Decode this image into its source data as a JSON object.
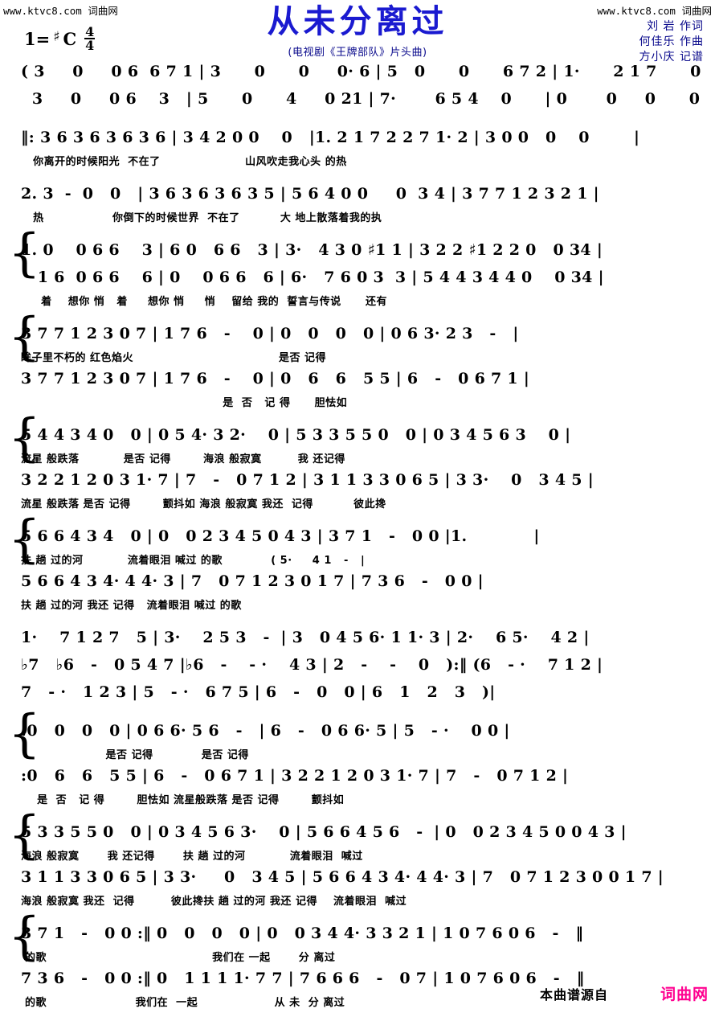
{
  "watermark": {
    "left_url": "www.ktvc8.com",
    "left_site": "词曲网",
    "right_url": "www.ktvc8.com",
    "right_site": "词曲网"
  },
  "header": {
    "title": "从未分离过",
    "subtitle": "(电视剧《王牌部队》片头曲)",
    "key_label": "1=",
    "key_accidental": "♯",
    "key_letter": "C",
    "time_numerator": "4",
    "time_denominator": "4",
    "credits": [
      "刘 岩 作词",
      "何佳乐 作曲",
      "方小庆 记谱"
    ]
  },
  "colors": {
    "title": "#1a1ad0",
    "subtitle": "#0a0a8c",
    "credits": "#0a0a8c",
    "notation": "#000000",
    "logo": "#ff0090"
  },
  "footer": {
    "source_text": "本曲谱源自",
    "logo_text": "词曲网"
  },
  "music": {
    "systems": [
      {
        "id": "sys-1-intro",
        "brace": false,
        "rows": [
          {
            "type": "notes",
            "voice": "upper",
            "text": "( 3     0     0 6  6 7 1 | 3      0      0     0· 6 | 5   0      0      6 7 2 | 1·      2 1 7      0        |"
          },
          {
            "type": "notes",
            "voice": "lower",
            "text": "  3     0     0 6    3   | 5      0      4     0 21 | 7·       6 5 4    0      | 0       0     0      0     )|"
          }
        ]
      },
      {
        "id": "sys-2",
        "brace": false,
        "rows": [
          {
            "type": "notes",
            "voice": "upper",
            "text": "‖: 3 6 3 6 3 6 3 6 | 3 4 2 0 0    0   |1. 2 1 7 2 2 7 1· 2 | 3 0 0   0    0        |"
          },
          {
            "type": "lyrics",
            "voice": "upper",
            "text": "   你离开的时候阳光  不在了                     山风吹走我心头 的热"
          }
        ]
      },
      {
        "id": "sys-3",
        "brace": false,
        "rows": [
          {
            "type": "notes",
            "voice": "upper",
            "text": "2. 3  -  0   0   | 3 6 3 6 3 6 3 5 | 5 6 4 0 0     0  3 4 | 3 7 7 1 2 3 2 1 |"
          },
          {
            "type": "lyrics",
            "voice": "upper",
            "text": "   热                 你倒下的时候世界  不在了          大 地上散落着我的执"
          }
        ]
      },
      {
        "id": "sys-4",
        "brace": true,
        "rows": [
          {
            "type": "notes",
            "voice": "upper",
            "text": "1. 0    0 6 6    3 | 6 0   6 6   3 | 3·   4 3 0 ♯1 1 | 3 2 2 ♯1 2 2 0   0 34 |"
          },
          {
            "type": "notes",
            "voice": "lower",
            "text": "   1 6  0 6 6    6 | 0    0 6 6   6 | 6·   7 6 0 3  3 | 5 4 4 3 4 4 0    0 34 |"
          },
          {
            "type": "lyrics",
            "voice": "both",
            "text": "     着    想你 悄   着     想你 悄     悄    留给 我的  誓言与传说      还有"
          }
        ]
      },
      {
        "id": "sys-5",
        "brace": true,
        "rows": [
          {
            "type": "notes",
            "voice": "upper",
            "text": "3 7 7 1 2 3 0 7 | 1 7 6   -    0 | 0   0   0   0 | 0 6 3· 2 3   -   |"
          },
          {
            "type": "lyrics",
            "voice": "upper",
            "text": "眸子里不朽的 红色焰火                                    是否 记得"
          },
          {
            "type": "notes",
            "voice": "lower",
            "text": "3 7 7 1 2 3 0 7 | 1 7 6   -    0 | 0   6   6   5 5 | 6   -   0 6 7 1 |"
          },
          {
            "type": "lyrics",
            "voice": "lower",
            "text": "                                                  是  否   记 得      胆怯如"
          }
        ]
      },
      {
        "id": "sys-6",
        "brace": true,
        "rows": [
          {
            "type": "notes",
            "voice": "upper",
            "text": "5 4 4 3 4 0   0 | 0 5 4· 3 2·    0 | 5 3 3 5 5 0   0 | 0 3 4 5 6 3    0 |"
          },
          {
            "type": "lyrics",
            "voice": "upper",
            "text": "流星 般跌落           是否 记得        海浪 般寂寞         我 还记得"
          },
          {
            "type": "notes",
            "voice": "lower",
            "text": "3 2 2 1 2 0 3 1· 7 | 7   -   0 7 1 2 | 3 1 1 3 3 0 6 5 | 3 3·    0   3 4 5 |"
          },
          {
            "type": "lyrics",
            "voice": "lower",
            "text": "流星 般跌落 是否 记得        颤抖如 海浪 般寂寞 我还  记得          彼此搀"
          }
        ]
      },
      {
        "id": "sys-7",
        "brace": true,
        "rows": [
          {
            "type": "notes",
            "voice": "upper",
            "text": "5 6 6 4 3 4   0 | 0   0 2 3 4 5 0 4 3 | 3 7 1   -   0 0 |1.            |"
          },
          {
            "type": "lyrics",
            "voice": "upper",
            "text": "扶 趟 过的河           流着眼泪 喊过 的歌            ( 5·     4 1   -   |"
          },
          {
            "type": "notes",
            "voice": "lower",
            "text": "5 6 6 4 3 4· 4 4· 3 | 7   0 7 1 2 3 0 1 7 | 7 3 6   -   0 0 |"
          },
          {
            "type": "lyrics",
            "voice": "lower",
            "text": "扶 趟 过的河 我还 记得   流着眼泪 喊过 的歌"
          }
        ]
      },
      {
        "id": "sys-8-interlude",
        "brace": false,
        "rows": [
          {
            "type": "notes",
            "voice": "upper",
            "text": "1·    7 1 2 7   5 | 3·    2 5 3   -  | 3   0 4 5 6· 1 1· 3 | 2·    6 5·    4 2 |"
          },
          {
            "type": "notes",
            "voice": "middle",
            "text": "♭7   ♭6   -   0 5 4 7 |♭6   -    - ·    4 3 | 2   -    -    0   ):‖ (6   - ·    7 1 2 |"
          },
          {
            "type": "notes",
            "voice": "lower",
            "text": "7   - ·   1 2 3 | 5   - ·   6 7 5 | 6   -   0   0 | 6   1   2   3   )|"
          }
        ]
      },
      {
        "id": "sys-9",
        "brace": true,
        "rows": [
          {
            "type": "notes",
            "voice": "upper",
            "text": ":0   0   0   0 | 0 6 6· 5 6   -   | 6   -   0 6 6· 5 | 5   - ·    0 0 |"
          },
          {
            "type": "lyrics",
            "voice": "upper",
            "text": "                     是否 记得            是否 记得"
          },
          {
            "type": "notes",
            "voice": "lower",
            "text": ":0   6   6   5 5 | 6   -   0 6 7 1 | 3 2 2 1 2 0 3 1· 7 | 7   -   0 7 1 2 |"
          },
          {
            "type": "lyrics",
            "voice": "lower",
            "text": "    是  否   记 得        胆怯如 流星般跌落 是否 记得        颤抖如"
          }
        ]
      },
      {
        "id": "sys-10",
        "brace": true,
        "rows": [
          {
            "type": "notes",
            "voice": "upper",
            "text": "5 3 3 5 5 0   0 | 0 3 4 5 6 3·    0 | 5 6 6 4 5 6   -  | 0   0 2 3 4 5 0 0 4 3 |"
          },
          {
            "type": "lyrics",
            "voice": "upper",
            "text": "海浪 般寂寞       我 还记得       扶 趟 过的河           流着眼泪  喊过"
          },
          {
            "type": "notes",
            "voice": "lower",
            "text": "3 1 1 3 3 0 6 5 | 3 3·     0   3 4 5 | 5 6 6 4 3 4· 4 4· 3 | 7   0 7 1 2 3 0 0 1 7 |"
          },
          {
            "type": "lyrics",
            "voice": "lower",
            "text": "海浪 般寂寞 我还  记得         彼此搀扶 趟 过的河 我还 记得    流着眼泪  喊过"
          }
        ]
      },
      {
        "id": "sys-11",
        "brace": true,
        "rows": [
          {
            "type": "notes",
            "voice": "upper",
            "text": "3 7 1   -   0 0 :‖ 0   0   0   0 | 0   0 3 4 4· 3 3 2 1 | 1 0 7 6 0 6   -   ‖"
          },
          {
            "type": "lyrics",
            "voice": "upper",
            "text": " 的歌                                         我们在 一起       分 离过"
          },
          {
            "type": "notes",
            "voice": "lower",
            "text": "7 3 6   -   0 0 :‖ 0   1 1 1 1· 7 7 | 7 6 6 6   -   0 7 | 1 0 7 6 0 6   -   ‖"
          },
          {
            "type": "lyrics",
            "voice": "lower",
            "text": " 的歌                      我们在  一起                   从 未  分 离过"
          }
        ]
      }
    ]
  }
}
